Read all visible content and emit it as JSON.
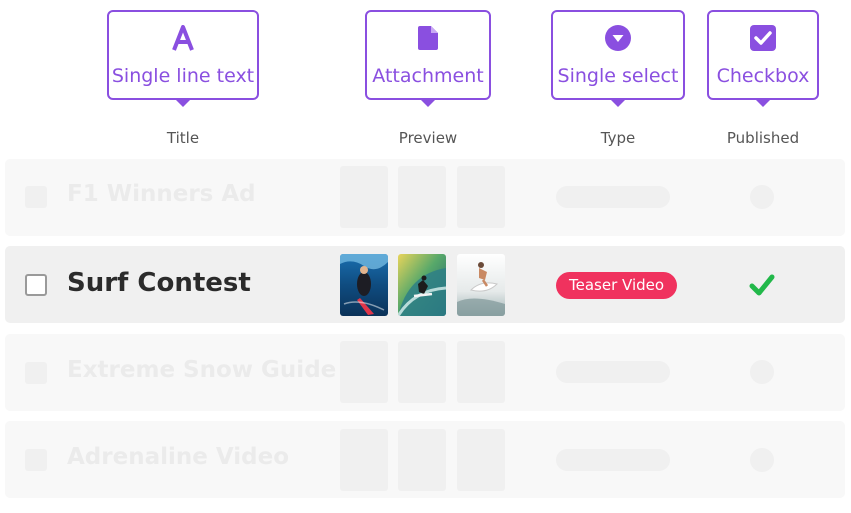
{
  "field_types": [
    {
      "label": "Single line text",
      "icon": "text-a-icon"
    },
    {
      "label": "Attachment",
      "icon": "file-icon"
    },
    {
      "label": "Single select",
      "icon": "dropdown-circle-icon"
    },
    {
      "label": "Checkbox",
      "icon": "checkbox-icon"
    }
  ],
  "columns": {
    "title": "Title",
    "preview": "Preview",
    "type": "Type",
    "published": "Published"
  },
  "rows": [
    {
      "title": "F1 Winners Ad",
      "state": "placeholder"
    },
    {
      "title": "Surf Contest",
      "state": "active",
      "type": "Teaser Video",
      "published": true,
      "preview_icons": [
        "surfer-underwater-photo",
        "surfer-wave-tube-photo",
        "surfer-jump-photo"
      ]
    },
    {
      "title": "Extreme Snow Guide",
      "state": "placeholder"
    },
    {
      "title": "Adrenaline Video",
      "state": "placeholder"
    }
  ],
  "colors": {
    "accent": "#8a4fe0",
    "badge": "#f0325e",
    "check": "#22b84a"
  }
}
